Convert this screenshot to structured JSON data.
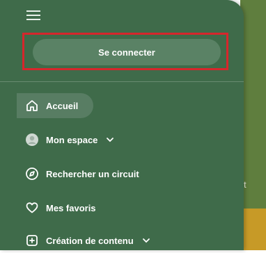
{
  "login": {
    "label": "Se connecter"
  },
  "nav": {
    "items": [
      {
        "label": "Accueil",
        "icon": "home-icon"
      },
      {
        "label": "Mon espace",
        "icon": "avatar-icon"
      },
      {
        "label": "Rechercher un circuit",
        "icon": "compass-icon"
      },
      {
        "label": "Mes favoris",
        "icon": "heart-icon"
      },
      {
        "label": "Création de contenu",
        "icon": "plus-square-icon"
      }
    ]
  },
  "background": {
    "partial_text": "t"
  },
  "colors": {
    "drawer": "#3f6b4a",
    "button": "#5a8265",
    "highlight": "#d7262c",
    "text": "#ffffff"
  }
}
